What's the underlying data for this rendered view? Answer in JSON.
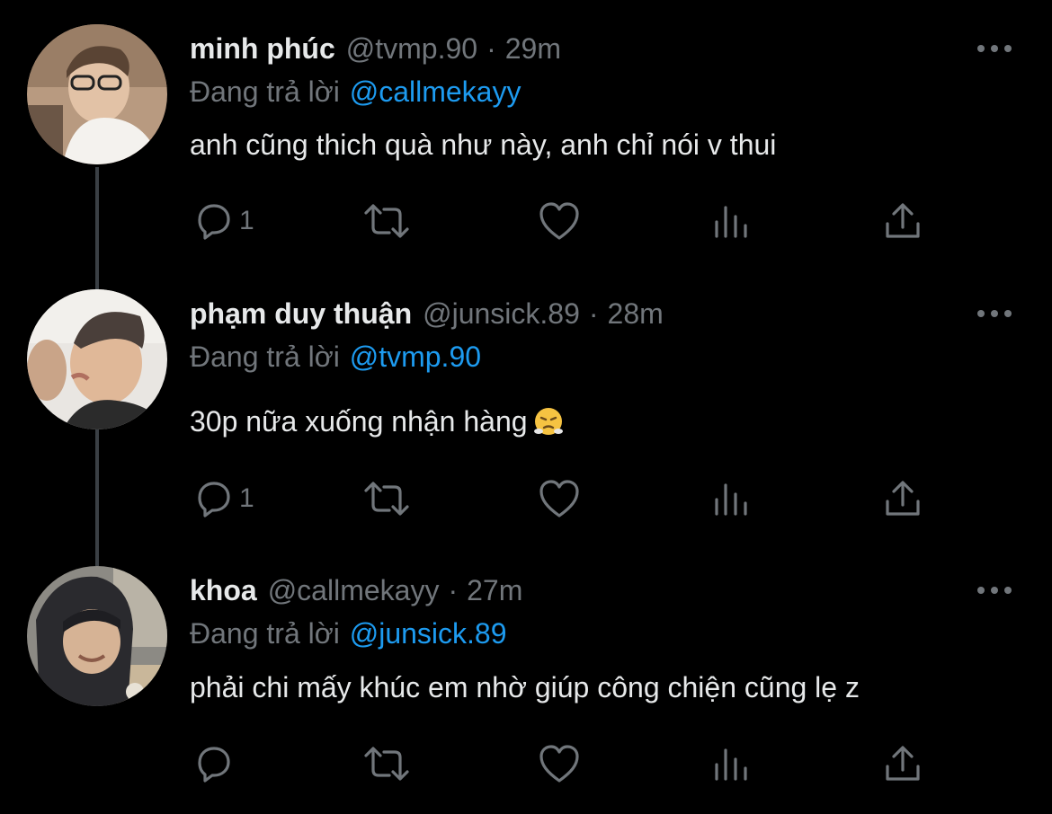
{
  "colors": {
    "background": "#000000",
    "primary_text": "#e7e9ea",
    "secondary_text": "#71767b",
    "link": "#1d9bf0",
    "thread_line": "#3a3f44"
  },
  "replying_prefix": "Đang trả lời",
  "tweets": [
    {
      "name": "minh phúc",
      "handle": "@tvmp.90",
      "separator": "·",
      "time": "29m",
      "reply_to": "@callmekayy",
      "text": "anh cũng thich quà như này, anh chỉ nói v thui",
      "reply_count": "1",
      "avatar_icon": "avatar-photo"
    },
    {
      "name": "phạm duy thuận",
      "handle": "@junsick.89",
      "separator": "·",
      "time": "28m",
      "reply_to": "@tvmp.90",
      "text": "30p nữa xuống nhận hàng",
      "emoji": "face-with-steam-from-nose",
      "reply_count": "1",
      "avatar_icon": "avatar-photo"
    },
    {
      "name": "khoa",
      "handle": "@callmekayy",
      "separator": "·",
      "time": "27m",
      "reply_to": "@junsick.89",
      "text": "phải chi mấy khúc em nhờ giúp công chiện cũng lẹ z",
      "reply_count": "",
      "avatar_icon": "avatar-photo"
    }
  ],
  "action_icons": [
    "reply-icon",
    "retweet-icon",
    "like-icon",
    "analytics-icon",
    "share-icon"
  ],
  "more_icon": "more-options-icon"
}
